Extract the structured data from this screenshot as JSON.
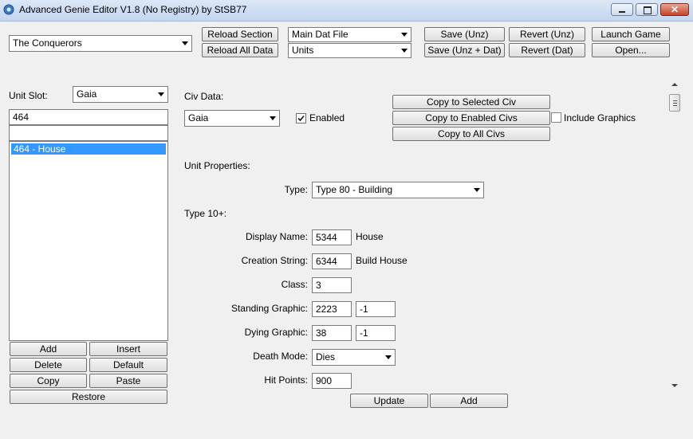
{
  "window": {
    "title": "Advanced Genie Editor V1.8 (No Registry) by StSB77"
  },
  "toolbar": {
    "game_combo": "The Conquerors",
    "reload_section": "Reload Section",
    "reload_all": "Reload All Data",
    "file_combo": "Main Dat File",
    "section_combo": "Units",
    "save_unz": "Save (Unz)",
    "save_unz_dat": "Save (Unz + Dat)",
    "revert_unz": "Revert (Unz)",
    "revert_dat": "Revert (Dat)",
    "launch_game": "Launch Game",
    "open": "Open..."
  },
  "left": {
    "unit_slot_label": "Unit Slot:",
    "unit_slot_value": "Gaia",
    "search_value": "464",
    "filter_value": "",
    "list_items": [
      "464 - House"
    ],
    "buttons": {
      "add": "Add",
      "insert": "Insert",
      "delete": "Delete",
      "default": "Default",
      "copy": "Copy",
      "paste": "Paste",
      "restore": "Restore"
    }
  },
  "civ": {
    "label": "Civ Data:",
    "value": "Gaia",
    "enabled_label": "Enabled",
    "enabled_checked": true,
    "copy_selected": "Copy to Selected Civ",
    "copy_enabled": "Copy to Enabled Civs",
    "copy_all": "Copy to All Civs",
    "include_graphics_label": "Include Graphics",
    "include_graphics_checked": false
  },
  "props": {
    "section_label": "Unit Properties:",
    "type_label": "Type:",
    "type_value": "Type 80 - Building",
    "type10_label": "Type 10+:",
    "display_name_label": "Display Name:",
    "display_name_value": "5344",
    "display_name_text": "House",
    "creation_string_label": "Creation String:",
    "creation_string_value": "6344",
    "creation_string_text": "Build House",
    "class_label": "Class:",
    "class_value": "3",
    "standing_graphic_label": "Standing Graphic:",
    "standing_graphic_1": "2223",
    "standing_graphic_2": "-1",
    "dying_graphic_label": "Dying Graphic:",
    "dying_graphic_1": "38",
    "dying_graphic_2": "-1",
    "death_mode_label": "Death Mode:",
    "death_mode_value": "Dies",
    "hit_points_label": "Hit Points:",
    "hit_points_value": "900",
    "update_button": "Update",
    "add_button": "Add"
  },
  "colors": {
    "selection": "#3399ff",
    "titlebar": "#c3d6ee"
  }
}
